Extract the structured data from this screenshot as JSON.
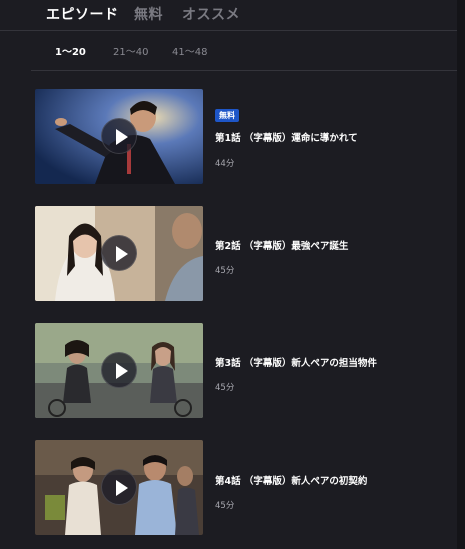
{
  "tabs": [
    {
      "label": "エピソード",
      "active": true
    },
    {
      "label": "無料",
      "active": false
    },
    {
      "label": "オススメ",
      "active": false
    }
  ],
  "ranges": [
    {
      "label": "1〜20",
      "active": true
    },
    {
      "label": "21〜40",
      "active": false
    },
    {
      "label": "41〜48",
      "active": false
    }
  ],
  "episodes": [
    {
      "badge": "無料",
      "title": "第1話 （字幕版）運命に導かれて",
      "duration": "44分",
      "play_icon": "play-icon"
    },
    {
      "title": "第2話 （字幕版）最強ペア誕生",
      "duration": "45分",
      "play_icon": "play-icon"
    },
    {
      "title": "第3話 （字幕版）新人ペアの担当物件",
      "duration": "45分",
      "play_icon": "play-icon"
    },
    {
      "title": "第4話 （字幕版）新人ペアの初契約",
      "duration": "45分",
      "play_icon": "play-icon"
    }
  ],
  "colors": {
    "background": "#1c1c22",
    "badge": "#1e56c8",
    "active_text": "#ffffff",
    "inactive_text": "#7a7a82"
  }
}
